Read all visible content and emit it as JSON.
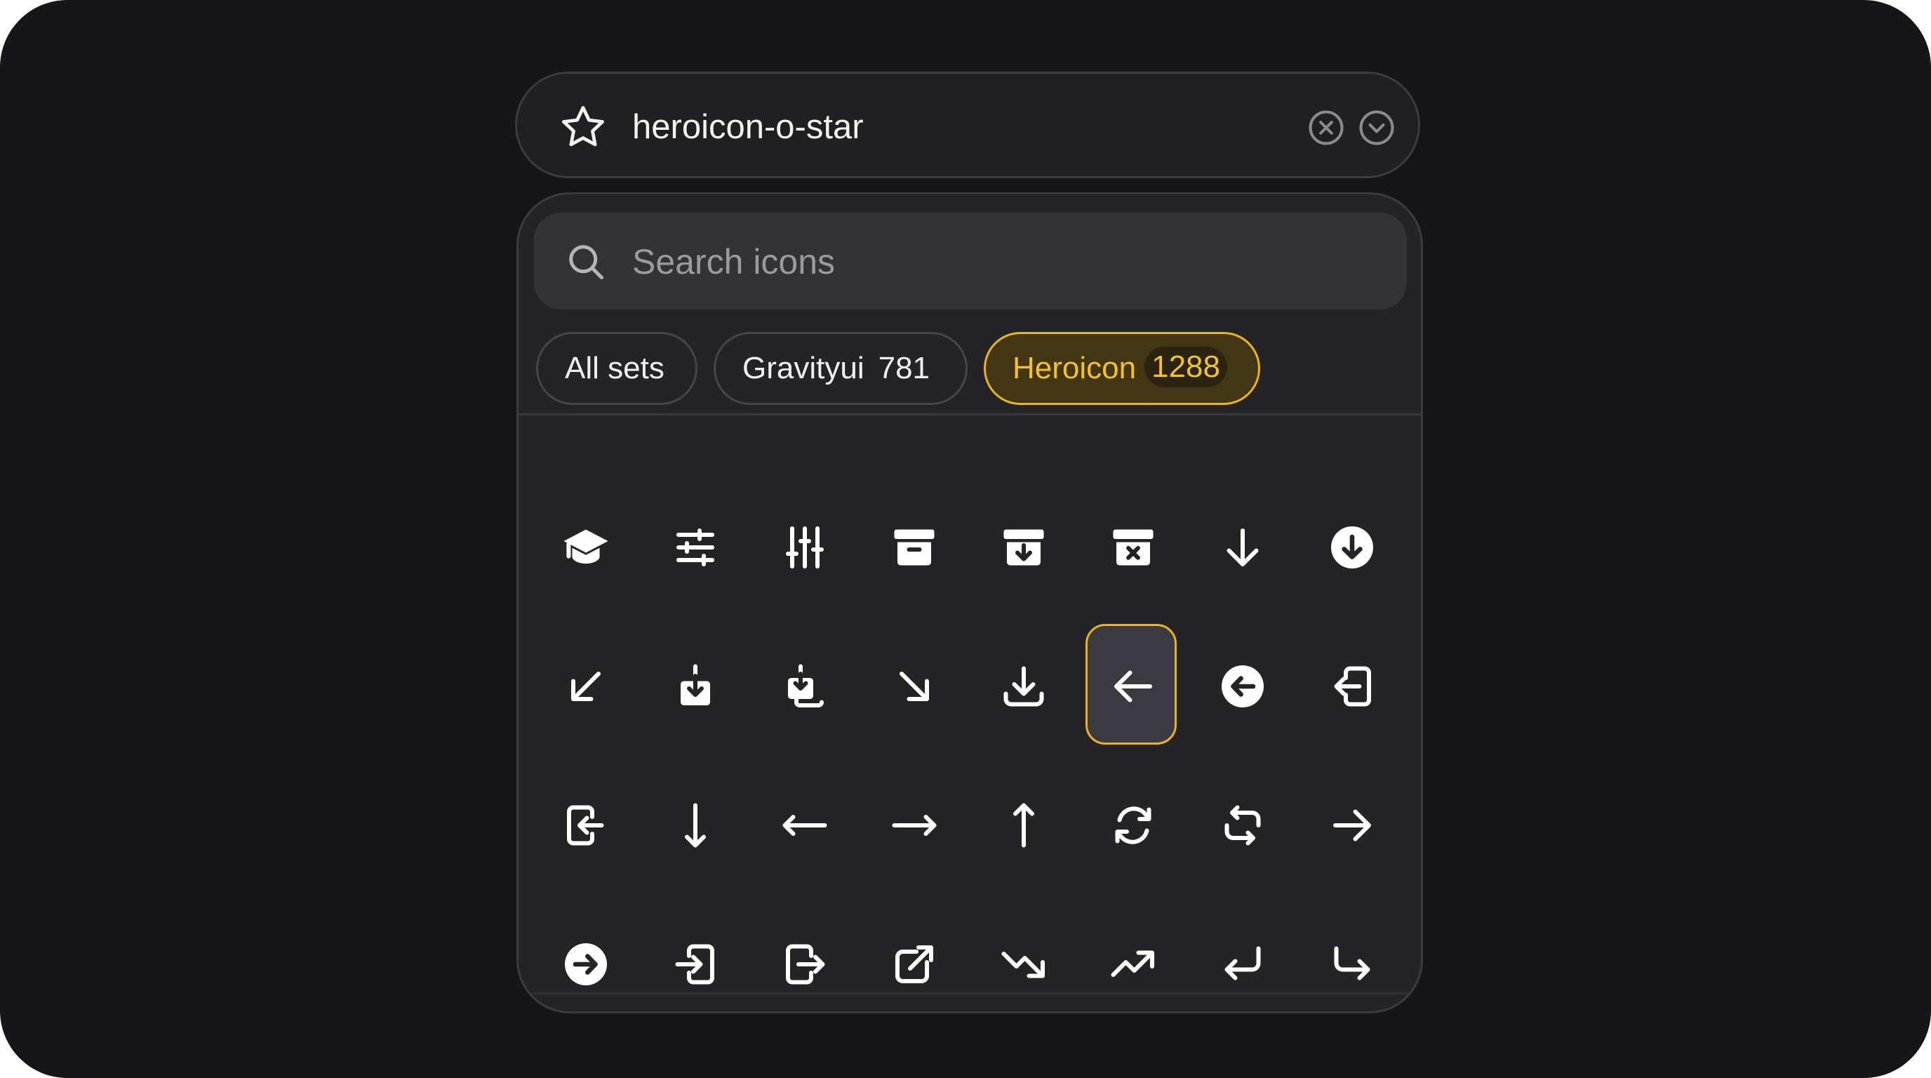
{
  "field": {
    "value": "heroicon-o-star",
    "icon": "star-outline-icon",
    "clear_icon": "x-circle-icon",
    "toggle_icon": "chevron-down-circle-icon"
  },
  "search": {
    "placeholder": "Search icons",
    "icon": "magnifying-glass-icon"
  },
  "filters": [
    {
      "label": "All sets",
      "count": ""
    },
    {
      "label": "Gravityui",
      "count": "781"
    },
    {
      "label": "Heroicon",
      "count": "1288",
      "active": true
    }
  ],
  "colors": {
    "accent": "#e8b51e",
    "background": "#161618",
    "panel": "#242427"
  },
  "icons": [
    [
      "academic-cap-icon",
      "adjustments-horizontal-icon",
      "adjustments-vertical-icon",
      "archive-box-icon",
      "archive-box-arrow-down-icon",
      "archive-box-x-mark-icon",
      "arrow-down-icon",
      "arrow-down-circle-icon"
    ],
    [
      "arrow-down-left-icon",
      "arrow-down-on-square-icon",
      "arrow-down-on-square-stack-icon",
      "arrow-down-right-icon",
      "arrow-down-tray-icon",
      "arrow-left-icon",
      "arrow-left-circle-icon",
      "arrow-left-end-on-rectangle-icon"
    ],
    [
      "arrow-left-start-on-rectangle-icon",
      "arrow-long-down-icon",
      "arrow-long-left-icon",
      "arrow-long-right-icon",
      "arrow-long-up-icon",
      "arrow-path-icon",
      "arrow-path-rounded-square-icon",
      "arrow-right-icon"
    ],
    [
      "arrow-right-circle-icon",
      "arrow-right-end-on-rectangle-icon",
      "arrow-right-start-on-rectangle-icon",
      "arrow-top-right-on-square-icon",
      "arrow-trending-down-icon",
      "arrow-trending-up-icon",
      "arrow-turn-down-left-icon",
      "arrow-turn-down-right-icon"
    ]
  ],
  "selected_icon": "arrow-left-icon"
}
